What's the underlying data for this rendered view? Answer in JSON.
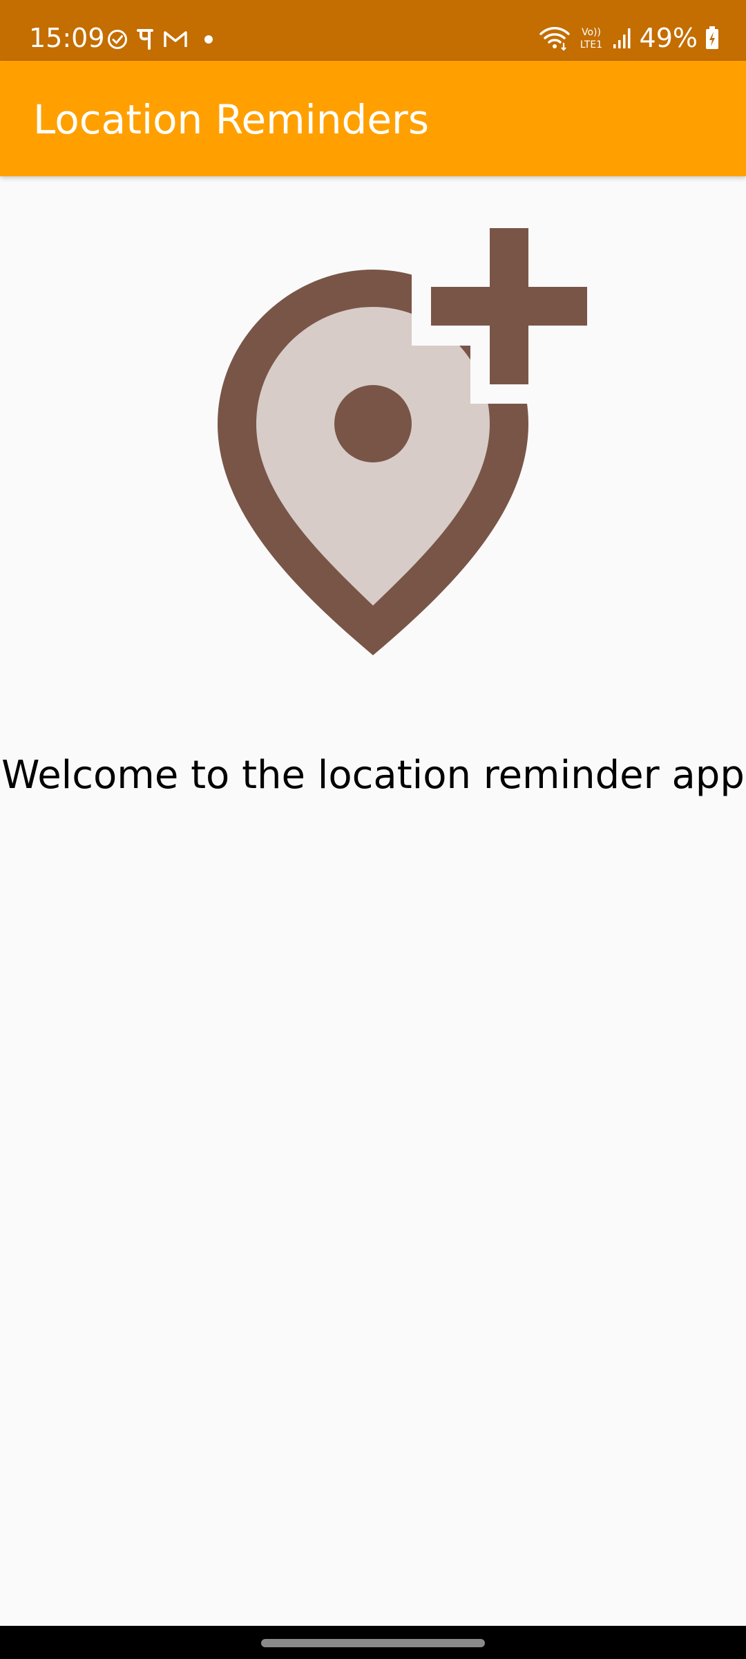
{
  "status_bar": {
    "time": "15:09",
    "battery_percent": "49%",
    "left_icons": [
      "check-circle-icon",
      "phonepe-icon",
      "gmail-icon",
      "dot-icon"
    ],
    "right_icons": [
      "wifi-icon",
      "volte-lte-icon",
      "signal-icon",
      "battery-charging-icon"
    ]
  },
  "app_bar": {
    "title": "Location Reminders",
    "color": "#ffa000"
  },
  "main": {
    "illustration_icon": "add-location-icon",
    "welcome_text": "Welcome to the location reminder app"
  },
  "colors": {
    "status_bar": "#c46d00",
    "accent": "#ffa000",
    "icon_dark": "#795548",
    "icon_light": "#d7ccc8",
    "background": "#fafafa"
  }
}
